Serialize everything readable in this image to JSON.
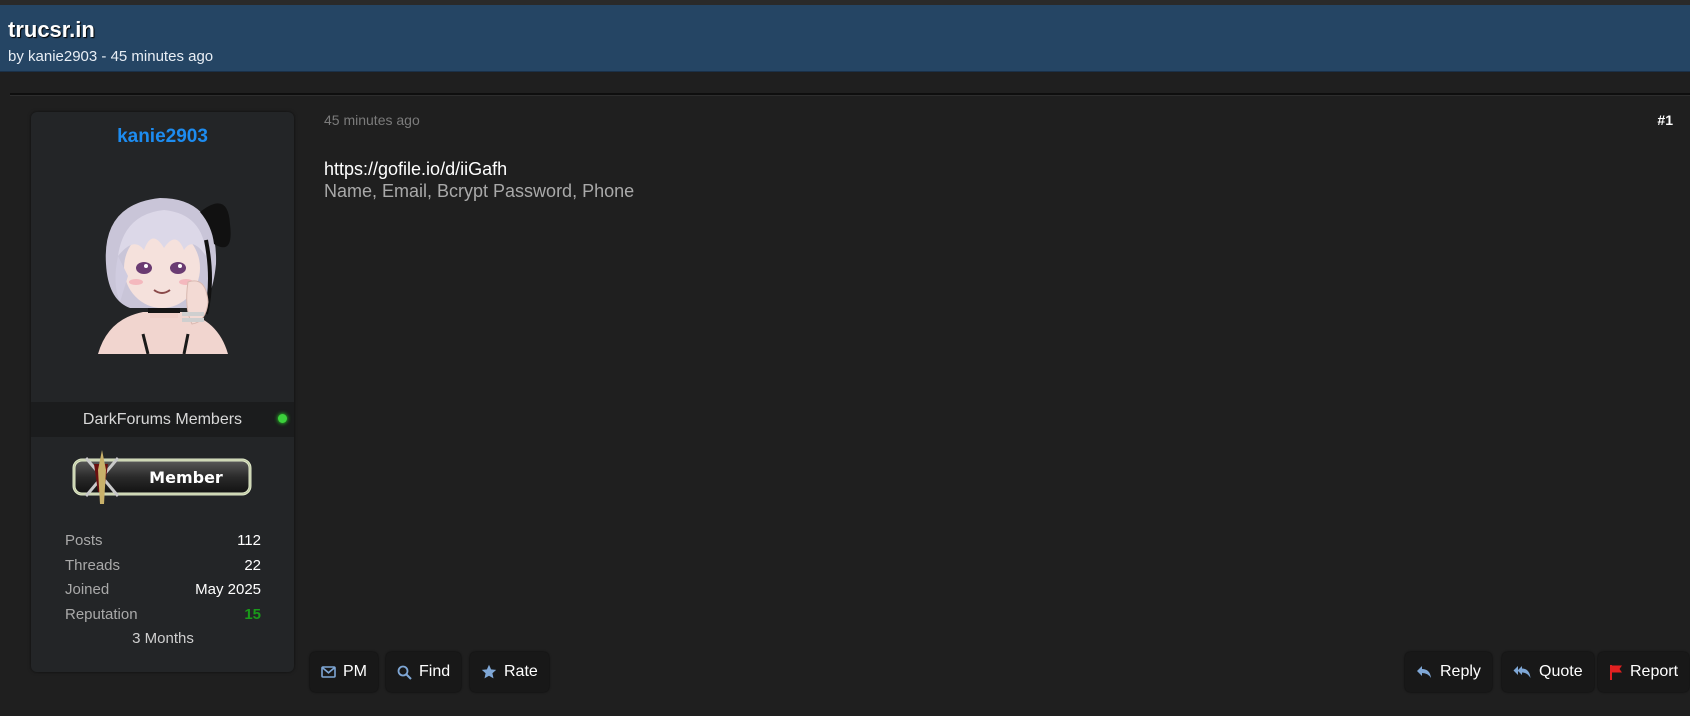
{
  "thread": {
    "title": "trucsr.in",
    "subtitle": "by kanie2903 - 45 minutes ago"
  },
  "author": {
    "username": "kanie2903",
    "usergroup": "DarkForums Members",
    "rank_badge": "Member",
    "stats": [
      {
        "label": "Posts",
        "value": "112"
      },
      {
        "label": "Threads",
        "value": "22"
      },
      {
        "label": "Joined",
        "value": "May 2025"
      },
      {
        "label": "Reputation",
        "value": "15"
      }
    ],
    "extra": "3 Months",
    "online": true
  },
  "post": {
    "date": "45 minutes ago",
    "number": "#1",
    "link": "https://gofile.io/d/iiGafh",
    "text": "Name, Email, Bcrypt Password, Phone"
  },
  "buttons": {
    "pm": "PM",
    "find": "Find",
    "rate": "Rate",
    "reply": "Reply",
    "quote": "Quote",
    "report": "Report"
  },
  "colors": {
    "header_bg": "#254564",
    "username": "#1d8cf0",
    "reputation": "#1a9a1a",
    "online": "#3cd13c",
    "report_flag": "#e02020",
    "icon_blue": "#7fa7d6"
  },
  "icons": {
    "pm": "envelope-icon",
    "find": "search-icon",
    "rate": "star-icon",
    "reply": "reply-icon",
    "quote": "quote-icon",
    "report": "flag-icon"
  }
}
